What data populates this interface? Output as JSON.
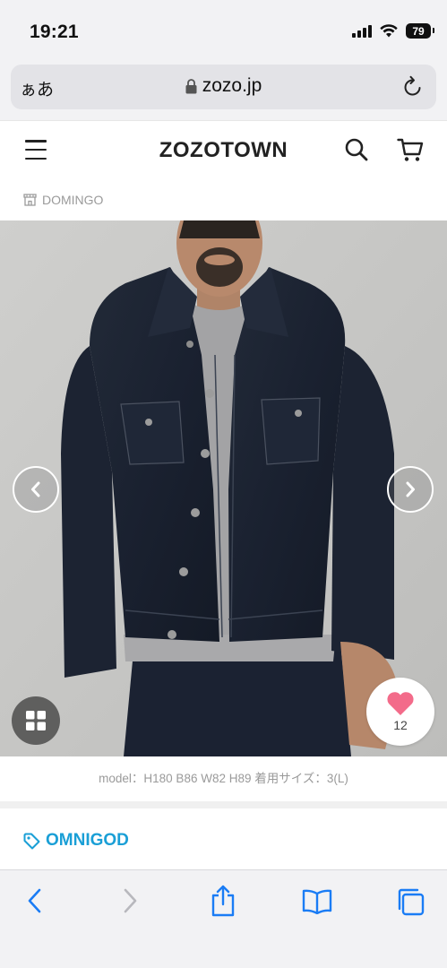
{
  "status_bar": {
    "time": "19:21",
    "battery": "79"
  },
  "browser": {
    "text_size_label": "ぁあ",
    "url": "zozo.jp"
  },
  "site": {
    "logo": "ZOZOTOWN"
  },
  "breadcrumb": {
    "shop": "DOMINGO"
  },
  "gallery": {
    "favorite_count": "12"
  },
  "product": {
    "model_info": "model：H180 B86 W82 H89 着用サイズ：3(L)",
    "brand": "OMNIGOD"
  },
  "colors": {
    "accent_blue": "#1a9fd6",
    "favorite_pink": "#f36b8a"
  }
}
